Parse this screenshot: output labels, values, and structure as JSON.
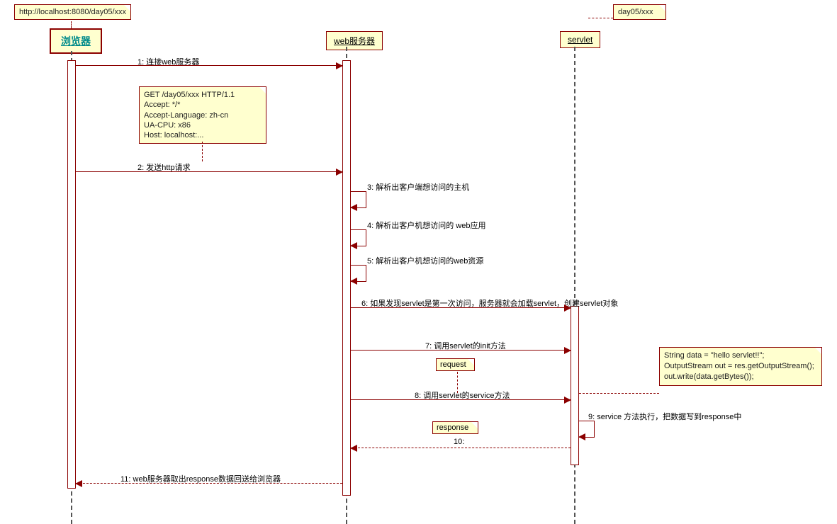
{
  "notes": {
    "url": "http://localhost:8080/day05/xxx",
    "servletPath": "day05/xxx",
    "httpRequest": "GET /day05/xxx HTTP/1.1\nAccept: */*\nAccept-Language: zh-cn\nUA-CPU: x86\nHost: localhost:...",
    "code": "String data = \"hello servlet!!\";\nOutputStream out = res.getOutputStream();\nout.write(data.getBytes());",
    "request": "request",
    "response": "response"
  },
  "lifelines": {
    "browser": "浏览器",
    "webServer": "web服务器",
    "servlet": "servlet"
  },
  "messages": {
    "m1": "1: 连接web服务器",
    "m2": "2: 发送http请求",
    "m3": "3: 解析出客户端想访问的主机",
    "m4": "4: 解析出客户机想访问的 web应用",
    "m5": "5: 解析出客户机想访问的web资源",
    "m6": "6: 如果发现servlet是第一次访问，服务器就会加载servlet，创建servlet对象",
    "m7": "7: 调用servlet的init方法",
    "m8": "8: 调用servlet的service方法",
    "m9": "9: service 方法执行，把数据写到response中",
    "m10": "10:",
    "m11": "11: web服务器取出response数据回送给浏览器"
  }
}
